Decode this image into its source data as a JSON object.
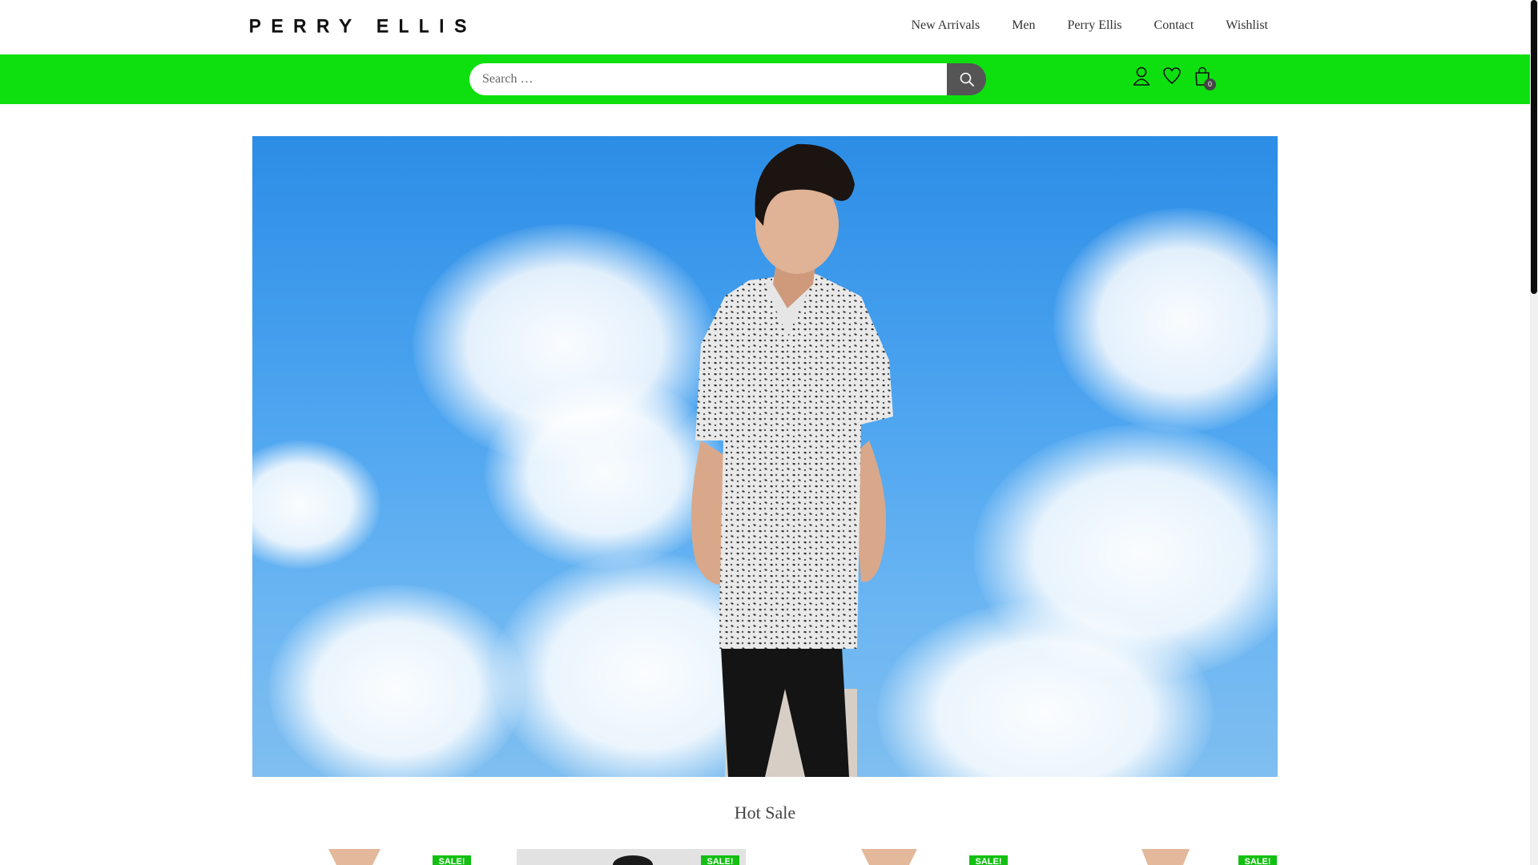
{
  "brand": {
    "logo_text": "PERRY ELLIS"
  },
  "nav": {
    "items": [
      {
        "label": "New Arrivals"
      },
      {
        "label": "Men"
      },
      {
        "label": "Perry Ellis"
      },
      {
        "label": "Contact"
      },
      {
        "label": "Wishlist"
      }
    ]
  },
  "search": {
    "placeholder": "Search …",
    "value": ""
  },
  "header_icons": {
    "account_icon": "user-icon",
    "wishlist_icon": "heart-icon",
    "cart_icon": "shopping-bag-icon",
    "cart_count": "0"
  },
  "hero": {
    "image": "man-in-printed-short-sleeve-shirt-against-cloudy-sky"
  },
  "hot_sale": {
    "title": "Hot Sale",
    "products": [
      {
        "badge": "SALE!"
      },
      {
        "badge": "SALE!"
      },
      {
        "badge": "SALE!"
      },
      {
        "badge": "SALE!"
      }
    ]
  },
  "colors": {
    "accent_green": "#0ee010",
    "search_button": "#555555",
    "badge_green": "#12bf12"
  }
}
